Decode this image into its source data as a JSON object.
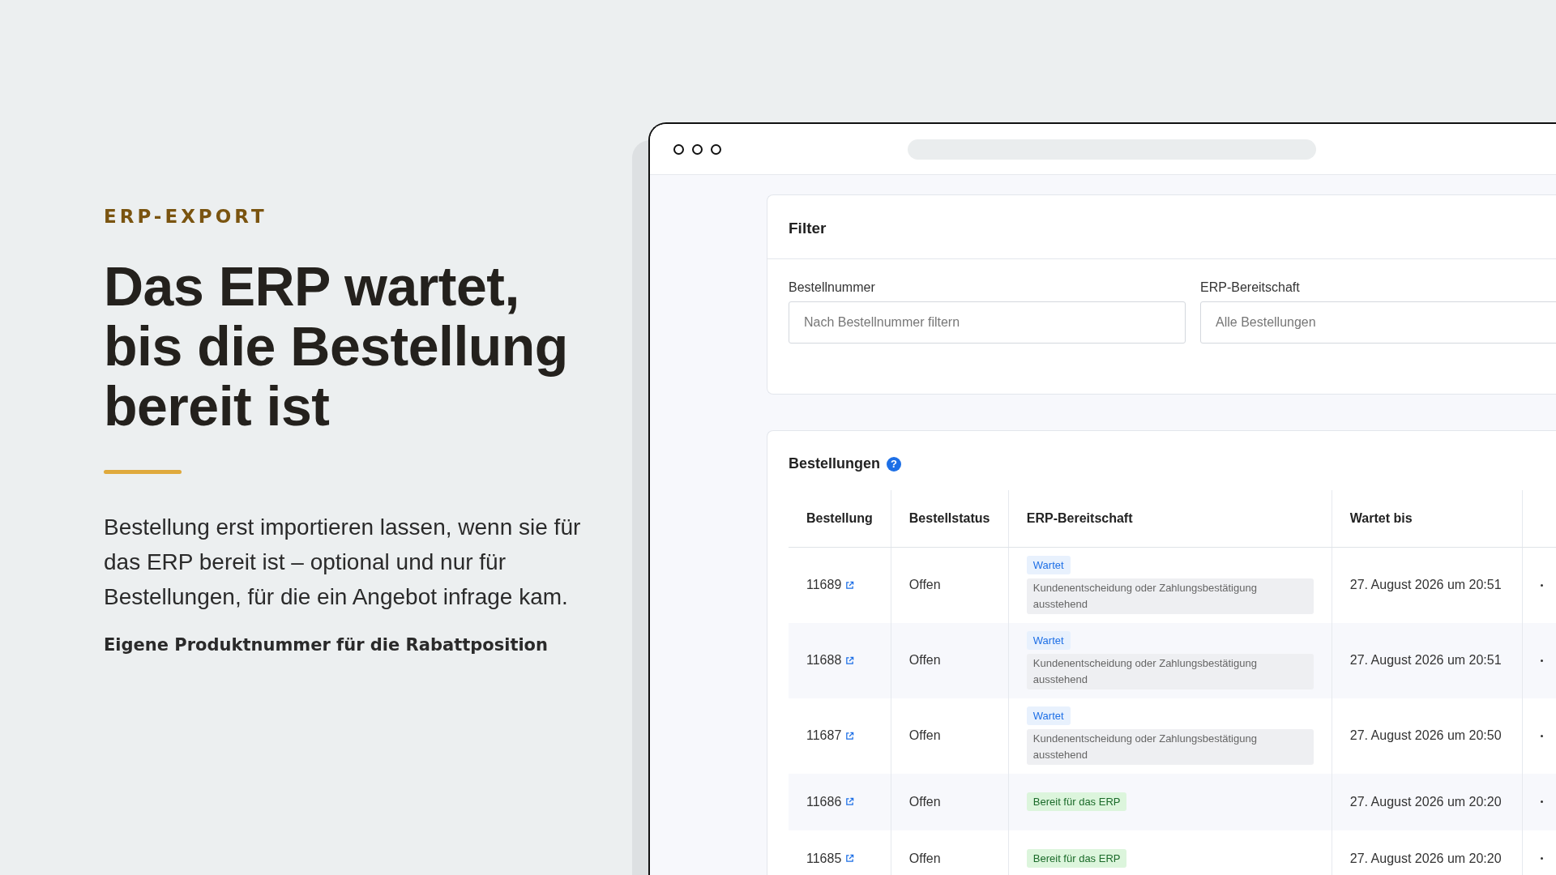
{
  "intro": {
    "kicker": "ERP-EXPORT",
    "headline_lines": [
      "Das ERP wartet,",
      "bis die Bestellung",
      "bereit ist"
    ],
    "body": "Bestellung erst importieren lassen, wenn sie für das ERP bereit ist – optional und nur für Bestellungen, für die ein Angebot infrage kam.",
    "feature": "Eigene Produktnummer für die Rabattposition"
  },
  "filter": {
    "title": "Filter",
    "fields": [
      {
        "label": "Bestellnummer",
        "placeholder": "Nach Bestellnummer filtern"
      },
      {
        "label": "ERP-Bereitschaft",
        "placeholder": "Alle Bestellungen"
      }
    ]
  },
  "orders": {
    "title": "Bestellungen",
    "help": "?",
    "columns": [
      "Bestellung",
      "Bestellstatus",
      "ERP-Bereitschaft",
      "Wartet bis"
    ],
    "rows": [
      {
        "order": "11689",
        "status": "Offen",
        "readiness": {
          "kind": "waiting",
          "label": "Wartet",
          "note": "Kundenentscheidung oder Zahlungsbestätigung ausstehend"
        },
        "until": "27. August 2026 um 20:51"
      },
      {
        "order": "11688",
        "status": "Offen",
        "readiness": {
          "kind": "waiting",
          "label": "Wartet",
          "note": "Kundenentscheidung oder Zahlungsbestätigung ausstehend"
        },
        "until": "27. August 2026 um 20:51"
      },
      {
        "order": "11687",
        "status": "Offen",
        "readiness": {
          "kind": "waiting",
          "label": "Wartet",
          "note": "Kundenentscheidung oder Zahlungsbestätigung ausstehend"
        },
        "until": "27. August 2026 um 20:50"
      },
      {
        "order": "11686",
        "status": "Offen",
        "readiness": {
          "kind": "ready",
          "label": "Bereit für das ERP"
        },
        "until": "27. August 2026 um 20:20"
      },
      {
        "order": "11685",
        "status": "Offen",
        "readiness": {
          "kind": "ready",
          "label": "Bereit für das ERP"
        },
        "until": "27. August 2026 um 20:20"
      }
    ]
  }
}
